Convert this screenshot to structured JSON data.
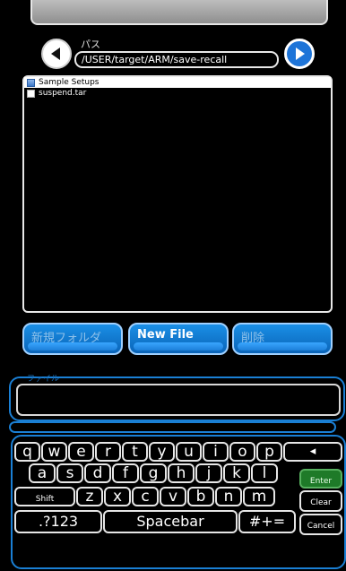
{
  "path": {
    "label": "パス",
    "value": "/USER/target/ARM/save-recall",
    "back_icon": "arrow-left-icon",
    "forward_icon": "arrow-right-icon"
  },
  "files": [
    {
      "name": "Sample Setups",
      "type": "folder",
      "selected": true
    },
    {
      "name": "suspend.tar",
      "type": "file",
      "selected": false
    }
  ],
  "actions": {
    "new_folder": "新規フォルダ",
    "new_file": "New File",
    "delete": "削除"
  },
  "filename": {
    "label": "ファイル",
    "value": ""
  },
  "keyboard": {
    "row1": [
      "q",
      "w",
      "e",
      "r",
      "t",
      "y",
      "u",
      "i",
      "o",
      "p"
    ],
    "row2": [
      "a",
      "s",
      "d",
      "f",
      "g",
      "h",
      "j",
      "k",
      "l"
    ],
    "row3": [
      "z",
      "x",
      "c",
      "v",
      "b",
      "n",
      "m"
    ],
    "backspace": "◂",
    "enter": "Enter",
    "shift": "Shift",
    "clear": "Clear",
    "numbers": ".?123",
    "space": "Spacebar",
    "symbols": "#+=",
    "cancel": "Cancel"
  },
  "colors": {
    "accent": "#1a7fd4",
    "enter_key": "#1e7a28"
  }
}
